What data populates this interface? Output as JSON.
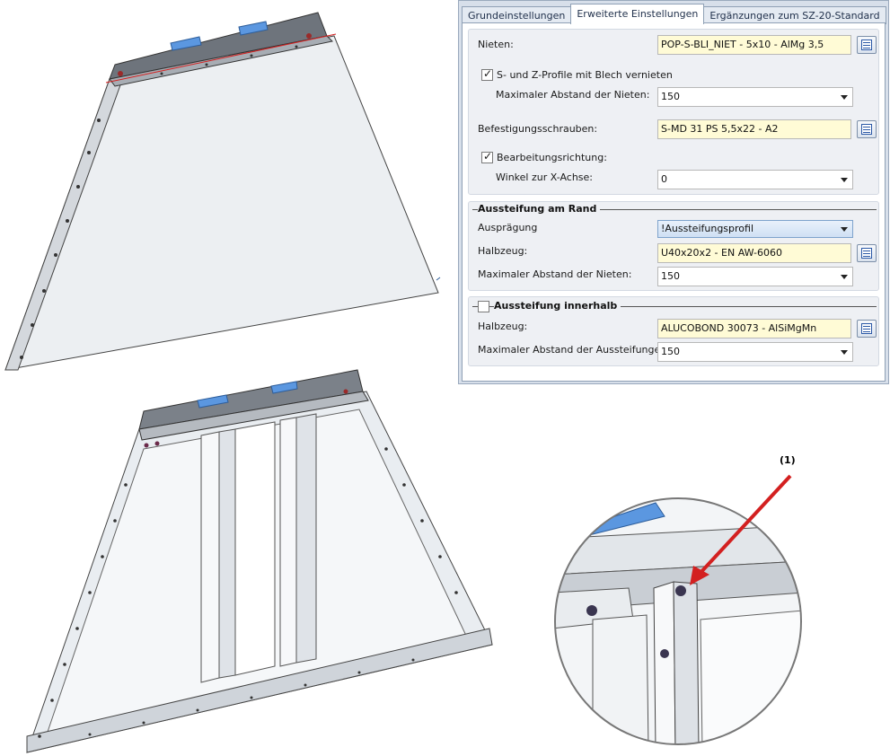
{
  "tabs": [
    {
      "label": "Grundeinstellungen",
      "active": false
    },
    {
      "label": "Erweiterte Einstellungen",
      "active": true
    },
    {
      "label": "Ergänzungen zum SZ-20-Standard",
      "active": false
    }
  ],
  "general": {
    "nieten_label": "Nieten:",
    "nieten_value": "POP-S-BLI_NIET -  5x10 - AlMg 3,5",
    "sz_profile_label": "S- und Z-Profile mit Blech vernieten",
    "sz_profile_checked": true,
    "max_abstand_nieten_label": "Maximaler Abstand der Nieten:",
    "max_abstand_nieten_value": "150",
    "befestigung_label": "Befestigungsschrauben:",
    "befestigung_value": "S-MD 31 PS 5,5x22 - A2",
    "bearbeitung_label": "Bearbeitungsrichtung:",
    "bearbeitung_checked": true,
    "winkel_label": "Winkel zur X-Achse:",
    "winkel_value": "0"
  },
  "aussteifung_rand": {
    "title": "Aussteifung am Rand",
    "auspraegung_label": "Ausprägung",
    "auspraegung_value": "!Aussteifungsprofil",
    "halbzeug_label": "Halbzeug:",
    "halbzeug_value": "U40x20x2 - EN AW-6060",
    "max_abstand_label": "Maximaler Abstand der Nieten:",
    "max_abstand_value": "150"
  },
  "aussteifung_innerhalb": {
    "title": "Aussteifung innerhalb",
    "checked": false,
    "halbzeug_label": "Halbzeug:",
    "halbzeug_value": "ALUCOBOND 30073 - AlSiMgMn",
    "max_abstand_label": "Maximaler Abstand der Aussteifungen:",
    "max_abstand_value": "150"
  },
  "callout_label": "(1)",
  "colors": {
    "panel_bg": "#d7dfea",
    "field_yellow": "#fffbd6",
    "model_blue": "#5b97e0",
    "arrow_red": "#d32020"
  }
}
